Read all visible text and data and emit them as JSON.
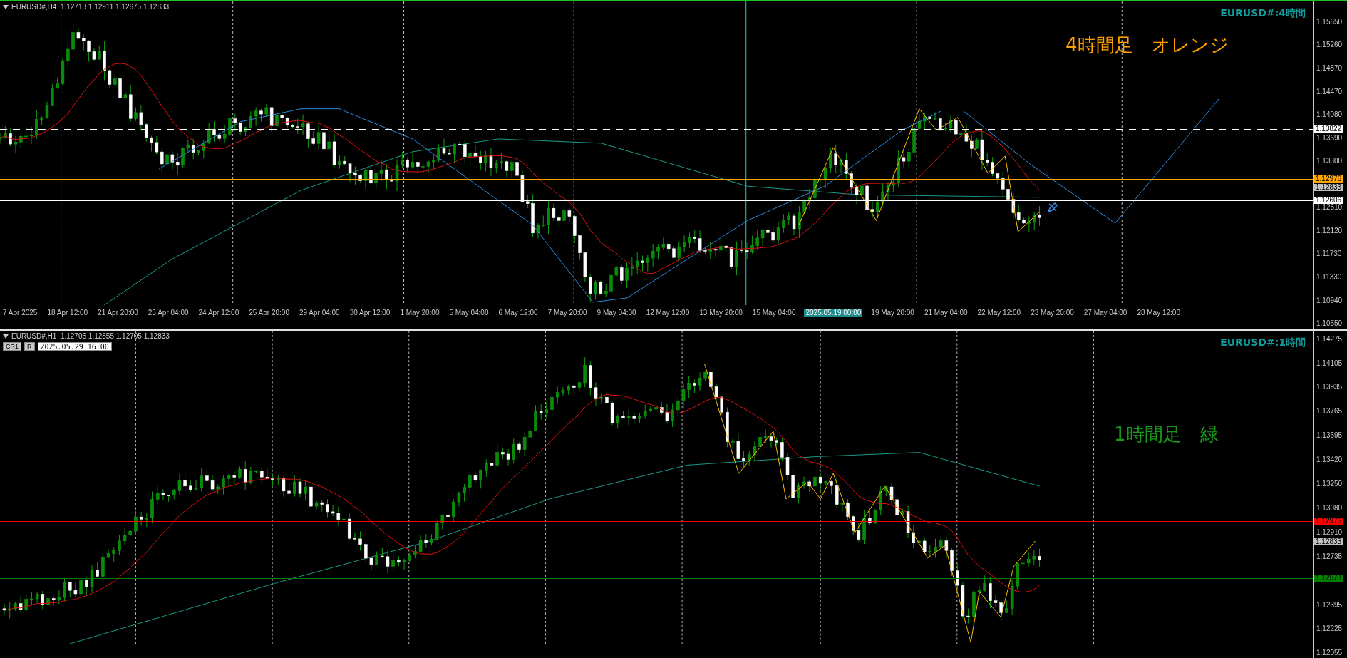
{
  "charts": [
    {
      "active": true,
      "symbol_info": "EURUSD#,H4  1.12713 1.12911 1.12675 1.12833",
      "corner_label": "EURUSD#:4時間",
      "note": {
        "text": "4時間足　オレンジ",
        "color": "#ffa000"
      },
      "price_ticks": [
        "1.15650",
        "1.15260",
        "1.14870",
        "1.14470",
        "1.14080",
        "1.13690",
        "1.13300",
        "1.12510",
        "1.12120",
        "1.11730",
        "1.11330",
        "1.10940",
        "1.10550"
      ],
      "price_tags": [
        {
          "price": "1.13822",
          "color": "#ffffff",
          "has_line": true,
          "dashed": true
        },
        {
          "price": "1.12976",
          "color": "#ffa500",
          "has_line": true,
          "dashed": false
        },
        {
          "price": "1.12833",
          "color": "#c0c0c0",
          "has_line": false
        },
        {
          "price": "1.12606",
          "color": "#ffffff",
          "has_line": true,
          "dashed": false
        }
      ],
      "time_labels": [
        {
          "label": "7 Apr 2025",
          "selected": false
        },
        {
          "label": "18 Apr 12:00",
          "selected": false
        },
        {
          "label": "21 Apr 20:00",
          "selected": false
        },
        {
          "label": "23 Apr 04:00",
          "selected": false
        },
        {
          "label": "24 Apr 12:00",
          "selected": false
        },
        {
          "label": "25 Apr 20:00",
          "selected": false
        },
        {
          "label": "29 Apr 04:00",
          "selected": false
        },
        {
          "label": "30 Apr 12:00",
          "selected": false
        },
        {
          "label": "1 May 20:00",
          "selected": false
        },
        {
          "label": "5 May 04:00",
          "selected": false
        },
        {
          "label": "6 May 12:00",
          "selected": false
        },
        {
          "label": "7 May 20:00",
          "selected": false
        },
        {
          "label": "9 May 04:00",
          "selected": false
        },
        {
          "label": "12 May 12:00",
          "selected": false
        },
        {
          "label": "13 May 20:00",
          "selected": false
        },
        {
          "label": "15 May 04:00",
          "selected": false
        },
        {
          "label": "2025.05.19 00:00",
          "selected": true
        },
        {
          "label": "19 May 20:00",
          "selected": false
        },
        {
          "label": "21 May 04:00",
          "selected": false
        },
        {
          "label": "22 May 12:00",
          "selected": false
        },
        {
          "label": "23 May 20:00",
          "selected": false
        },
        {
          "label": "27 May 04:00",
          "selected": false
        },
        {
          "label": "28 May 12:00",
          "selected": false
        }
      ]
    },
    {
      "active": false,
      "symbol_info": "EURUSD#,H1  1.12705 1.12855 1.12705 1.12833",
      "corner_label": "EURUSD#:1時間",
      "note": {
        "text": "1時間足　緑",
        "color": "#1a9a1a"
      },
      "tool_row": {
        "buttons": [
          "CR1",
          "R"
        ],
        "date": "2025.05.29 16:00"
      },
      "price_ticks": [
        "1.14275",
        "1.14105",
        "1.13935",
        "1.13765",
        "1.13595",
        "1.13420",
        "1.13250",
        "1.13080",
        "1.12910",
        "1.12735",
        "1.12395",
        "1.12225",
        "1.12055"
      ],
      "price_tags": [
        {
          "price": "1.12976",
          "color": "#ff0000",
          "has_line": true,
          "dashed": false
        },
        {
          "price": "1.12833",
          "color": "#c0c0c0",
          "has_line": false
        },
        {
          "price": "1.12573",
          "color": "#008000",
          "has_line": true,
          "dashed": false
        }
      ]
    }
  ]
}
